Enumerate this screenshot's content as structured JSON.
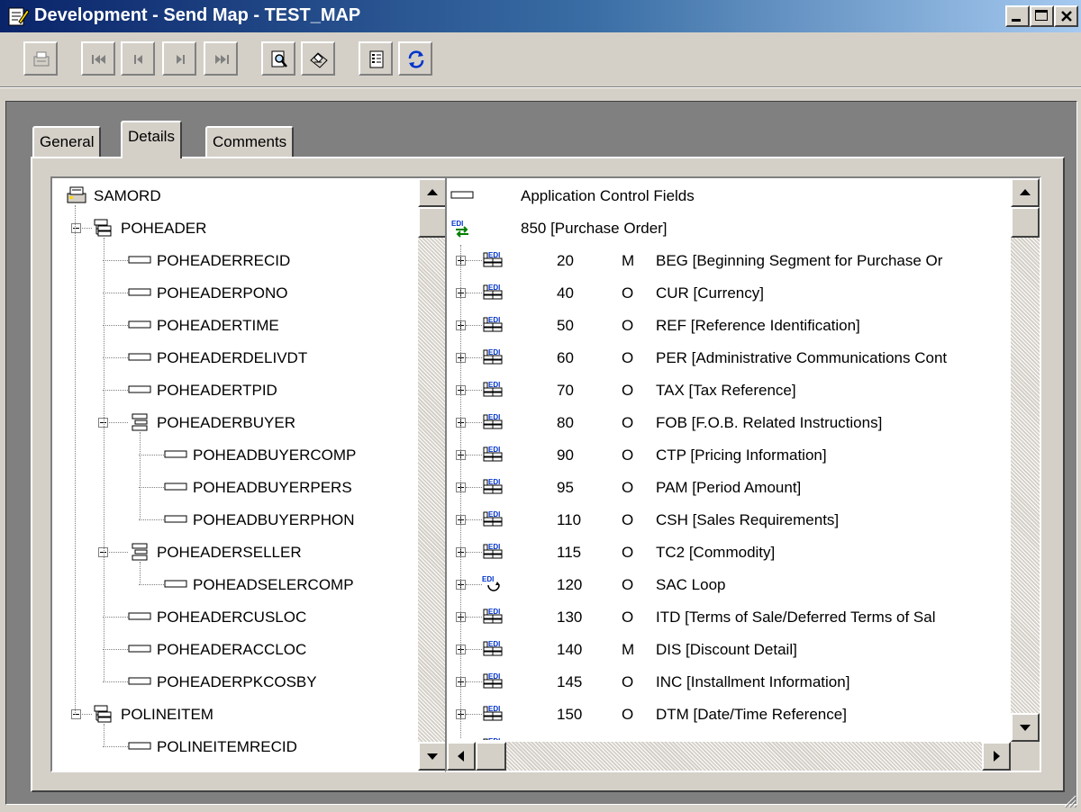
{
  "window": {
    "title": "Development - Send Map - TEST_MAP",
    "controls": [
      "minimize",
      "maximize",
      "close"
    ]
  },
  "toolbar": {
    "buttons": [
      {
        "name": "exit-icon",
        "enabled": false
      },
      {
        "name": "first-record-icon",
        "enabled": false
      },
      {
        "name": "previous-record-icon",
        "enabled": false
      },
      {
        "name": "next-record-icon",
        "enabled": false
      },
      {
        "name": "last-record-icon",
        "enabled": false
      },
      {
        "name": "print-preview-icon",
        "enabled": true
      },
      {
        "name": "print-icon",
        "enabled": true
      },
      {
        "name": "properties-icon",
        "enabled": true
      },
      {
        "name": "refresh-icon",
        "enabled": true
      }
    ]
  },
  "tabs": [
    {
      "label": "General",
      "active": false
    },
    {
      "label": "Details",
      "active": true
    },
    {
      "label": "Comments",
      "active": false
    }
  ],
  "left_tree": [
    {
      "label": "SAMORD",
      "depth": 0,
      "icon": "database-icon",
      "expander": "none"
    },
    {
      "label": "POHEADER",
      "depth": 1,
      "icon": "record-icon",
      "expander": "minus"
    },
    {
      "label": "POHEADERRECID",
      "depth": 2,
      "icon": "field-icon",
      "expander": "none"
    },
    {
      "label": "POHEADERPONO",
      "depth": 2,
      "icon": "field-icon",
      "expander": "none"
    },
    {
      "label": "POHEADERTIME",
      "depth": 2,
      "icon": "field-icon",
      "expander": "none"
    },
    {
      "label": "POHEADERDELIVDT",
      "depth": 2,
      "icon": "field-icon",
      "expander": "none"
    },
    {
      "label": "POHEADERTPID",
      "depth": 2,
      "icon": "field-icon",
      "expander": "none"
    },
    {
      "label": "POHEADERBUYER",
      "depth": 2,
      "icon": "group-icon",
      "expander": "minus"
    },
    {
      "label": "POHEADBUYERCOMP",
      "depth": 3,
      "icon": "field-icon",
      "expander": "none"
    },
    {
      "label": "POHEADBUYERPERS",
      "depth": 3,
      "icon": "field-icon",
      "expander": "none"
    },
    {
      "label": "POHEADBUYERPHON",
      "depth": 3,
      "icon": "field-icon",
      "expander": "none"
    },
    {
      "label": "POHEADERSELLER",
      "depth": 2,
      "icon": "group-icon",
      "expander": "minus"
    },
    {
      "label": "POHEADSELERCOMP",
      "depth": 3,
      "icon": "field-icon",
      "expander": "none"
    },
    {
      "label": "POHEADERCUSLOC",
      "depth": 2,
      "icon": "field-icon",
      "expander": "none"
    },
    {
      "label": "POHEADERACCLOC",
      "depth": 2,
      "icon": "field-icon",
      "expander": "none"
    },
    {
      "label": "POHEADERPKCOSBY",
      "depth": 2,
      "icon": "field-icon",
      "expander": "none"
    },
    {
      "label": "POLINEITEM",
      "depth": 1,
      "icon": "record-icon",
      "expander": "minus"
    },
    {
      "label": "POLINEITEMRECID",
      "depth": 2,
      "icon": "field-icon",
      "expander": "none"
    }
  ],
  "right_tree": {
    "header_rows": [
      {
        "label": "Application Control Fields",
        "icon": "field-icon"
      },
      {
        "label": "850 [Purchase Order]",
        "icon": "edi-transaction-icon"
      }
    ],
    "segments": [
      {
        "seq": "20",
        "req": "M",
        "label": "BEG [Beginning Segment for Purchase Or",
        "icon": "edi-segment-icon"
      },
      {
        "seq": "40",
        "req": "O",
        "label": "CUR [Currency]",
        "icon": "edi-segment-icon"
      },
      {
        "seq": "50",
        "req": "O",
        "label": "REF [Reference Identification]",
        "icon": "edi-segment-icon"
      },
      {
        "seq": "60",
        "req": "O",
        "label": "PER [Administrative Communications Cont",
        "icon": "edi-segment-icon"
      },
      {
        "seq": "70",
        "req": "O",
        "label": "TAX [Tax Reference]",
        "icon": "edi-segment-icon"
      },
      {
        "seq": "80",
        "req": "O",
        "label": "FOB [F.O.B. Related Instructions]",
        "icon": "edi-segment-icon"
      },
      {
        "seq": "90",
        "req": "O",
        "label": "CTP [Pricing Information]",
        "icon": "edi-segment-icon"
      },
      {
        "seq": "95",
        "req": "O",
        "label": "PAM [Period Amount]",
        "icon": "edi-segment-icon"
      },
      {
        "seq": "110",
        "req": "O",
        "label": "CSH [Sales Requirements]",
        "icon": "edi-segment-icon"
      },
      {
        "seq": "115",
        "req": "O",
        "label": "TC2 [Commodity]",
        "icon": "edi-segment-icon"
      },
      {
        "seq": "120",
        "req": "O",
        "label": "SAC Loop",
        "icon": "edi-loop-icon"
      },
      {
        "seq": "130",
        "req": "O",
        "label": "ITD [Terms of Sale/Deferred Terms of Sal",
        "icon": "edi-segment-icon"
      },
      {
        "seq": "140",
        "req": "M",
        "label": "DIS [Discount Detail]",
        "icon": "edi-segment-icon"
      },
      {
        "seq": "145",
        "req": "O",
        "label": "INC [Installment Information]",
        "icon": "edi-segment-icon"
      },
      {
        "seq": "150",
        "req": "O",
        "label": "DTM [Date/Time Reference]",
        "icon": "edi-segment-icon"
      }
    ]
  },
  "colors": {
    "titlebar_start": "#0a246a",
    "titlebar_end": "#a6caf0",
    "face": "#d4d0c8",
    "workspace": "#808080"
  }
}
